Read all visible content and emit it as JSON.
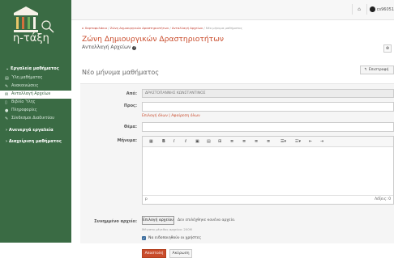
{
  "logo": {
    "text": "η-τάξη"
  },
  "nav": {
    "head1": "Εργαλεία μαθήματος",
    "items": [
      {
        "icon": "tasks-icon",
        "glyph": "▤",
        "label": "Ύλη μαθήματος"
      },
      {
        "icon": "bullhorn-icon",
        "glyph": "✎",
        "label": "Ανακοινώσεις"
      },
      {
        "icon": "envelope-icon",
        "glyph": "✉",
        "label": "Ανταλλαγή Αρχείων"
      },
      {
        "icon": "book-icon",
        "glyph": "▯",
        "label": "Βιβλίο Ύλης"
      },
      {
        "icon": "info-icon",
        "glyph": "●",
        "label": "Πληροφορίες"
      },
      {
        "icon": "link-icon",
        "glyph": "✎",
        "label": "Σύνδεσμοι Διαδικτύου"
      }
    ],
    "head2": "Ανενεργά εργαλεία",
    "head3": "Διαχείριση μαθήματος"
  },
  "topbar": {
    "user": "cs96051",
    "home_icon": "home-icon"
  },
  "breadcrumb": {
    "items": [
      "Χαρτοφυλάκιο",
      "Ζώνη Δημιουργικών Δραστηριοτήτων",
      "Ανταλλαγή Αρχείων",
      "Νέο μήνυμα μαθήματος"
    ]
  },
  "page": {
    "title": "Ζώνη Δημιουργικών Δραστηριοτήτων",
    "subtitle": "Ανταλλαγή Αρχείων",
    "section_title": "Νέο μήνυμα μαθήματος",
    "back_label": "Επιστροφή"
  },
  "form": {
    "from_label": "Από:",
    "from_value": "ΔΡΑΣΤΟΠΑΝΝΗΣ ΚΩΝΣΤΑΝΤΙΝΟΣ",
    "to_label": "Προς:",
    "select_all": "Επιλογή όλων",
    "sep": " | ",
    "remove_all": "Αφαίρεση όλων",
    "subject_label": "Θέμα:",
    "message_label": "Μήνυμα:",
    "editor_path": "p",
    "word_count": "Λέξεις: 0",
    "file_label": "Συνημμένο αρχείο:",
    "file_button": "Επιλογή αρχείου",
    "file_status": "Δεν επιλέχθηκε κανένα αρχείο.",
    "max_size": "Μέγιστο μέγεθος αρχείου: 200M",
    "notify_label": "Να ειδοποιηθούν οι χρήστες",
    "notify_checked": true,
    "send_button": "Αποστολή",
    "cancel_button": "Ακύρωση"
  }
}
